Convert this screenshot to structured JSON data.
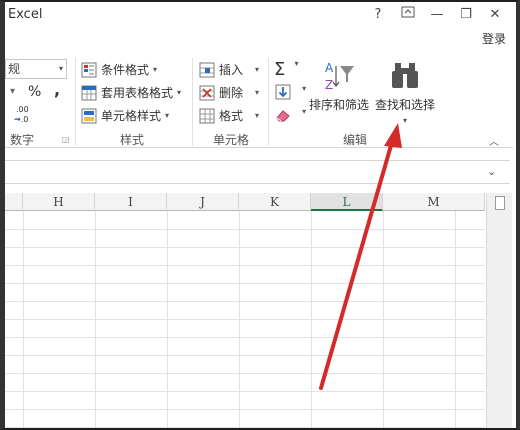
{
  "title": {
    "app": "Excel"
  },
  "window": {
    "help": "?",
    "restore_ribbon": "⊼",
    "minimize": "—",
    "maximize": "❐",
    "close": "✕",
    "signin": "登录"
  },
  "ribbon": {
    "number": {
      "format_value": "规",
      "percent": "%",
      "comma": ",",
      "decimals": ".00\n→.0",
      "label": "数字"
    },
    "styles": {
      "conditional": "条件格式",
      "table": "套用表格格式",
      "cell": "单元格样式",
      "label": "样式"
    },
    "cells": {
      "insert": "插入",
      "delete": "删除",
      "format": "格式",
      "label": "单元格"
    },
    "editing": {
      "sort_filter": "排序和筛选",
      "find_select": "查找和选择",
      "label": "编辑"
    }
  },
  "sheet": {
    "columns": [
      "H",
      "I",
      "J",
      "K",
      "L",
      "M"
    ],
    "active_column": "L"
  },
  "colors": {
    "accent_green": "#217346",
    "arrow_red": "#d42a2a"
  }
}
